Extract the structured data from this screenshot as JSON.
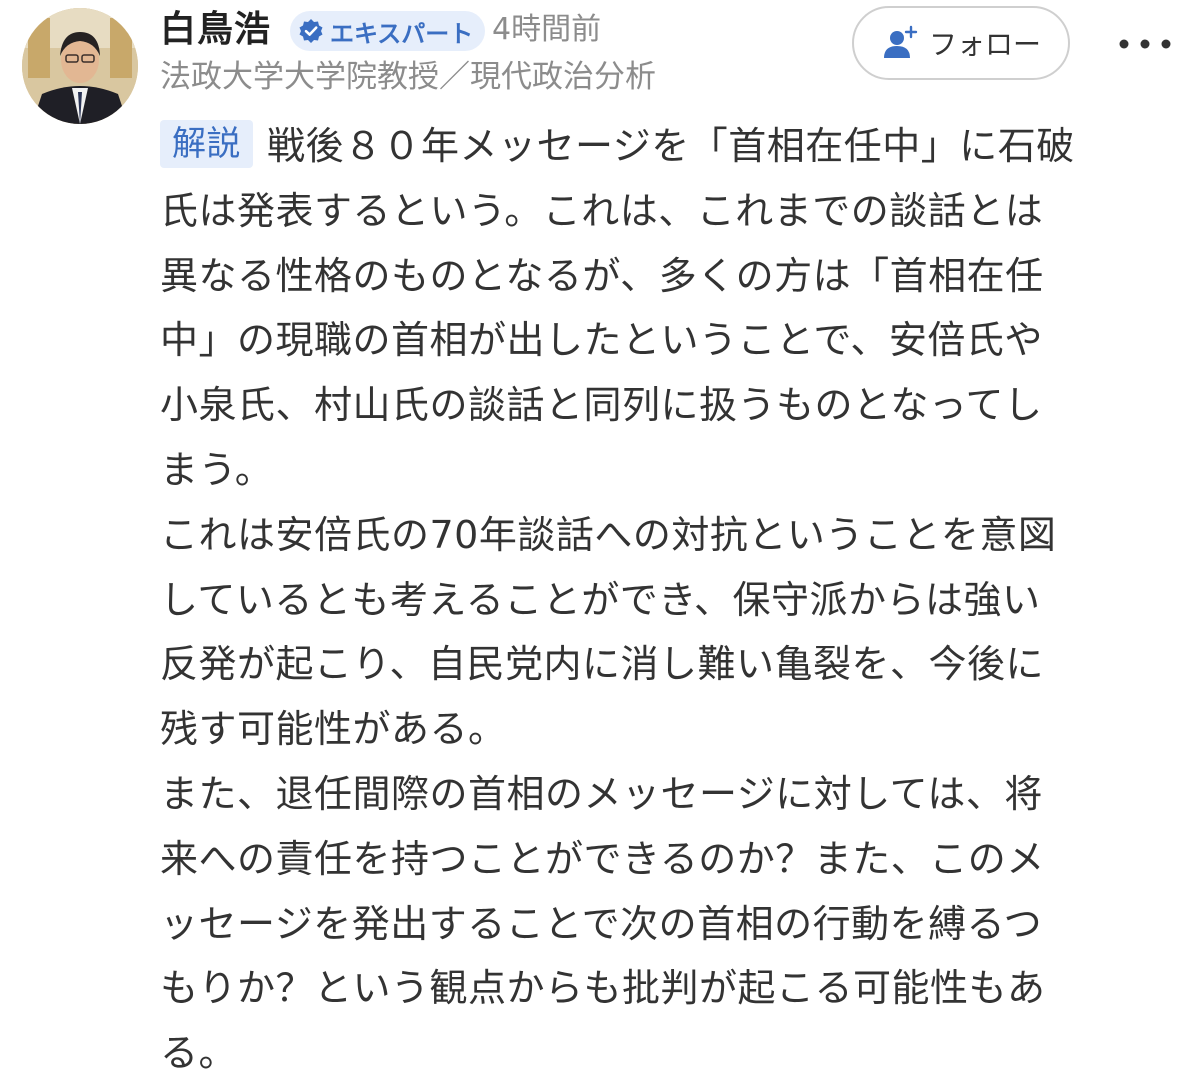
{
  "author": {
    "name": "白鳥浩",
    "badge": "エキスパート",
    "time": "4時間前",
    "profession": "法政大学大学院教授／現代政治分析",
    "avatar_icon": "author-photo"
  },
  "actions": {
    "follow_label": "フォロー",
    "follow_icon": "user-plus-icon",
    "more_icon": "more-horizontal-icon"
  },
  "comment": {
    "tag": "解説",
    "first_line": "戦後８０年メッセージを「首相在任中」に石破",
    "lines": [
      "氏は発表するという。これは、これまでの談話とは",
      "異なる性格のものとなるが、多くの方は「首相在任",
      "中」の現職の首相が出したということで、安倍氏や",
      "小泉氏、村山氏の談話と同列に扱うものとなってし",
      "まう。",
      "これは安倍氏の70年談話への対抗ということを意図",
      "しているとも考えることができ、保守派からは強い",
      "反発が起こり、自民党内に消し難い亀裂を、今後に",
      "残す可能性がある。",
      "また、退任間際の首相のメッセージに対しては、将",
      "来への責任を持つことができるのか？また、このメ",
      "ッセージを発出することで次の首相の行動を縛るつ",
      "もりか？という観点からも批判が起こる可能性もあ",
      "る。"
    ]
  },
  "colors": {
    "accent_blue": "#3a6ec2",
    "badge_bg": "#e6eefb",
    "muted_text": "#8c8c8c",
    "body_text": "#333333"
  }
}
